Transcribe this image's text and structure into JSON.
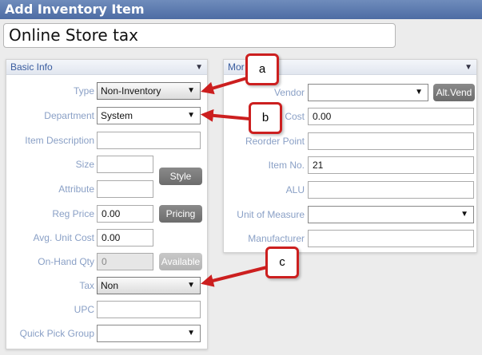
{
  "window": {
    "title": "Add Inventory Item"
  },
  "item_name": "Online Store tax",
  "basic_info": {
    "header": "Basic Info",
    "collapse_glyph": "▼",
    "fields": {
      "type": {
        "label": "Type",
        "value": "Non-Inventory"
      },
      "department": {
        "label": "Department",
        "value": "System"
      },
      "item_description": {
        "label": "Item Description",
        "value": ""
      },
      "size": {
        "label": "Size",
        "value": ""
      },
      "attribute": {
        "label": "Attribute",
        "value": ""
      },
      "reg_price": {
        "label": "Reg Price",
        "value": "0.00"
      },
      "avg_unit_cost": {
        "label": "Avg. Unit Cost",
        "value": "0.00"
      },
      "on_hand_qty": {
        "label": "On-Hand Qty",
        "value": "0"
      },
      "tax": {
        "label": "Tax",
        "value": "Non"
      },
      "upc": {
        "label": "UPC",
        "value": ""
      },
      "quick_pick_group": {
        "label": "Quick Pick Group",
        "value": ""
      }
    },
    "buttons": {
      "style": "Style",
      "pricing": "Pricing",
      "available": "Available"
    }
  },
  "more_panel": {
    "header": "Mor",
    "collapse_glyph": "▼",
    "fields": {
      "vendor": {
        "label": "Vendor",
        "value": ""
      },
      "cost": {
        "label": "Cost",
        "value": "0.00"
      },
      "reorder_point": {
        "label": "Reorder Point",
        "value": ""
      },
      "item_no": {
        "label": "Item No.",
        "value": "21"
      },
      "alu": {
        "label": "ALU",
        "value": ""
      },
      "unit_of_measure": {
        "label": "Unit of Measure",
        "value": ""
      },
      "manufacturer": {
        "label": "Manufacturer",
        "value": ""
      }
    },
    "buttons": {
      "alt_vend": "Alt.Vend"
    }
  },
  "dropdown_glyph": "▼",
  "callouts": {
    "a": "a",
    "b": "b",
    "c": "c"
  },
  "colors": {
    "title_bar": "#5a78ad",
    "label": "#8aa0c6",
    "header_text": "#3a5da0",
    "callout_red": "#cc1f1f",
    "button_gray": "#7a7a7a"
  }
}
